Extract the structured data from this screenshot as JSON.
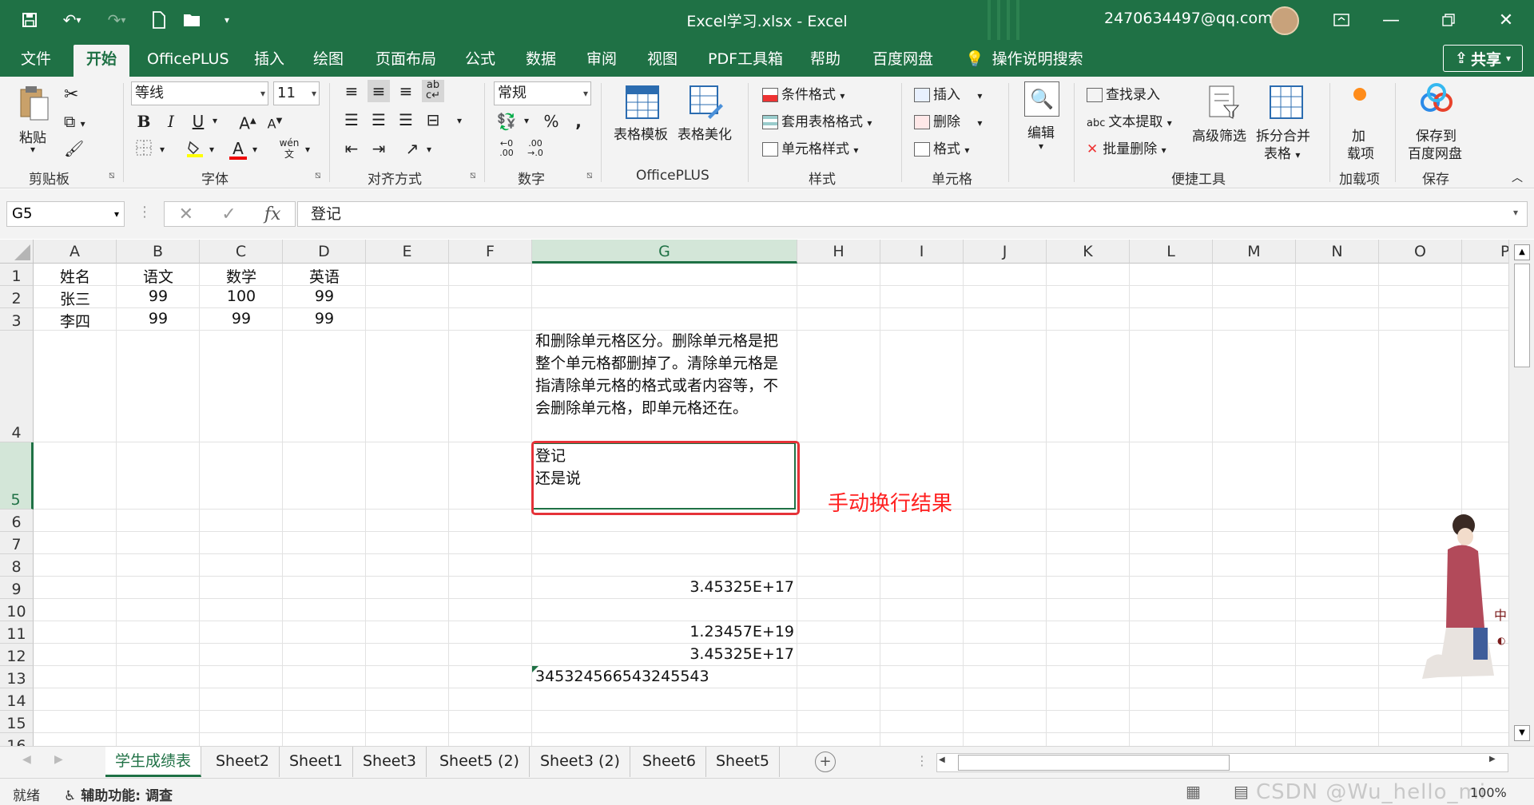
{
  "titlebar": {
    "title": "Excel学习.xlsx  -  Excel",
    "user": "2470634497@qq.com",
    "qat": [
      "save-icon",
      "undo-icon",
      "redo-icon",
      "new-file-icon",
      "open-file-icon",
      "customize-icon"
    ]
  },
  "tabs": [
    {
      "label": "文件"
    },
    {
      "label": "开始",
      "active": true
    },
    {
      "label": "OfficePLUS"
    },
    {
      "label": "插入"
    },
    {
      "label": "绘图"
    },
    {
      "label": "页面布局"
    },
    {
      "label": "公式"
    },
    {
      "label": "数据"
    },
    {
      "label": "审阅"
    },
    {
      "label": "视图"
    },
    {
      "label": "PDF工具箱"
    },
    {
      "label": "帮助"
    },
    {
      "label": "百度网盘"
    },
    {
      "label": "操作说明搜索"
    }
  ],
  "share_label": "共享",
  "ribbon": {
    "clipboard": {
      "paste": "粘贴",
      "label": "剪贴板"
    },
    "font": {
      "name": "等线",
      "size": "11",
      "label": "字体",
      "bold": "B",
      "italic": "I",
      "underline": "U"
    },
    "align": {
      "label": "对齐方式"
    },
    "number": {
      "format": "常规",
      "label": "数字",
      "percent": "%",
      "comma": ","
    },
    "officeplus": {
      "template": "表格模板",
      "beautify": "表格美化",
      "label": "OfficePLUS"
    },
    "styles": {
      "conditional": "条件格式",
      "table_format": "套用表格格式",
      "cell_style": "单元格样式",
      "label": "样式"
    },
    "cells": {
      "insert": "插入",
      "delete": "删除",
      "format": "格式",
      "label": "单元格"
    },
    "edit": {
      "label": "编辑"
    },
    "tools": {
      "find": "查找录入",
      "extract": "文本提取",
      "batch_delete": "批量删除",
      "filter": "高级筛选",
      "split": "拆分合并",
      "split2": "表格",
      "label": "便捷工具"
    },
    "addins": {
      "btn1": "加",
      "btn2": "载项",
      "label": "加载项"
    },
    "save": {
      "btn1": "保存到",
      "btn2": "百度网盘",
      "label": "保存"
    }
  },
  "formula": {
    "namebox": "G5",
    "value": "登记"
  },
  "columns": [
    "A",
    "B",
    "C",
    "D",
    "E",
    "F",
    "G",
    "H",
    "I",
    "J",
    "K",
    "L",
    "M",
    "N",
    "O",
    "P"
  ],
  "rows": [
    "1",
    "2",
    "3",
    "4",
    "5",
    "6",
    "7",
    "8",
    "9",
    "10",
    "11",
    "12",
    "13",
    "14",
    "15",
    "16"
  ],
  "cells": {
    "A1": "姓名",
    "B1": "语文",
    "C1": "数学",
    "D1": "英语",
    "A2": "张三",
    "B2": "99",
    "C2": "100",
    "D2": "99",
    "A3": "李四",
    "B3": "99",
    "C3": "99",
    "D3": "99",
    "G4": "和删除单元格区分。删除单元格是把整个单元格都删掉了。清除单元格是指清除单元格的格式或者内容等，不会删除单元格，即单元格还在。",
    "G5_line1": "登记",
    "G5_line2": "还是说",
    "G9": "3.45325E+17",
    "G11": "1.23457E+19",
    "G12": "3.45325E+17",
    "G13": "345324566543245543"
  },
  "annotation": "手动换行结果",
  "sheets": [
    {
      "label": "学生成绩表",
      "active": true
    },
    {
      "label": "Sheet2"
    },
    {
      "label": "Sheet1"
    },
    {
      "label": "Sheet3"
    },
    {
      "label": "Sheet5 (2)"
    },
    {
      "label": "Sheet3 (2)"
    },
    {
      "label": "Sheet6"
    },
    {
      "label": "Sheet5"
    }
  ],
  "status": {
    "ready": "就绪",
    "accessibility": "辅助功能: 调查",
    "zoom": "100%",
    "watermark": "CSDN @Wu_hello_mi"
  }
}
